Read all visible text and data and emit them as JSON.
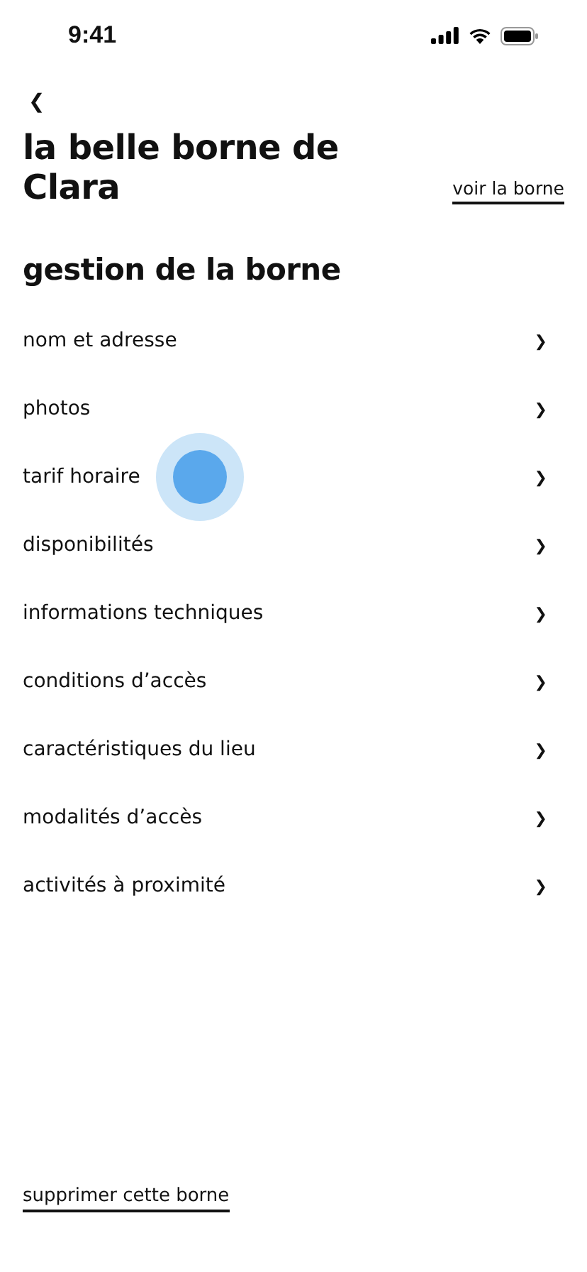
{
  "status_bar": {
    "time": "9:41"
  },
  "header": {
    "back": "❮",
    "title": "la belle borne de Clara",
    "link": "voir la borne"
  },
  "section": {
    "title": "gestion de la borne",
    "items": [
      {
        "label": "nom et adresse",
        "chevron": "❯",
        "touched": false
      },
      {
        "label": "photos",
        "chevron": "❯",
        "touched": false
      },
      {
        "label": "tarif horaire",
        "chevron": "❯",
        "touched": true
      },
      {
        "label": "disponibilités",
        "chevron": "❯",
        "touched": false
      },
      {
        "label": "informations techniques",
        "chevron": "❯",
        "touched": false
      },
      {
        "label": "conditions d’accès",
        "chevron": "❯",
        "touched": false
      },
      {
        "label": "caractéristiques du lieu",
        "chevron": "❯",
        "touched": false
      },
      {
        "label": "modalités d’accès",
        "chevron": "❯",
        "touched": false
      },
      {
        "label": "activités à proximité",
        "chevron": "❯",
        "touched": false
      }
    ]
  },
  "footer": {
    "delete_link": "supprimer cette borne"
  }
}
